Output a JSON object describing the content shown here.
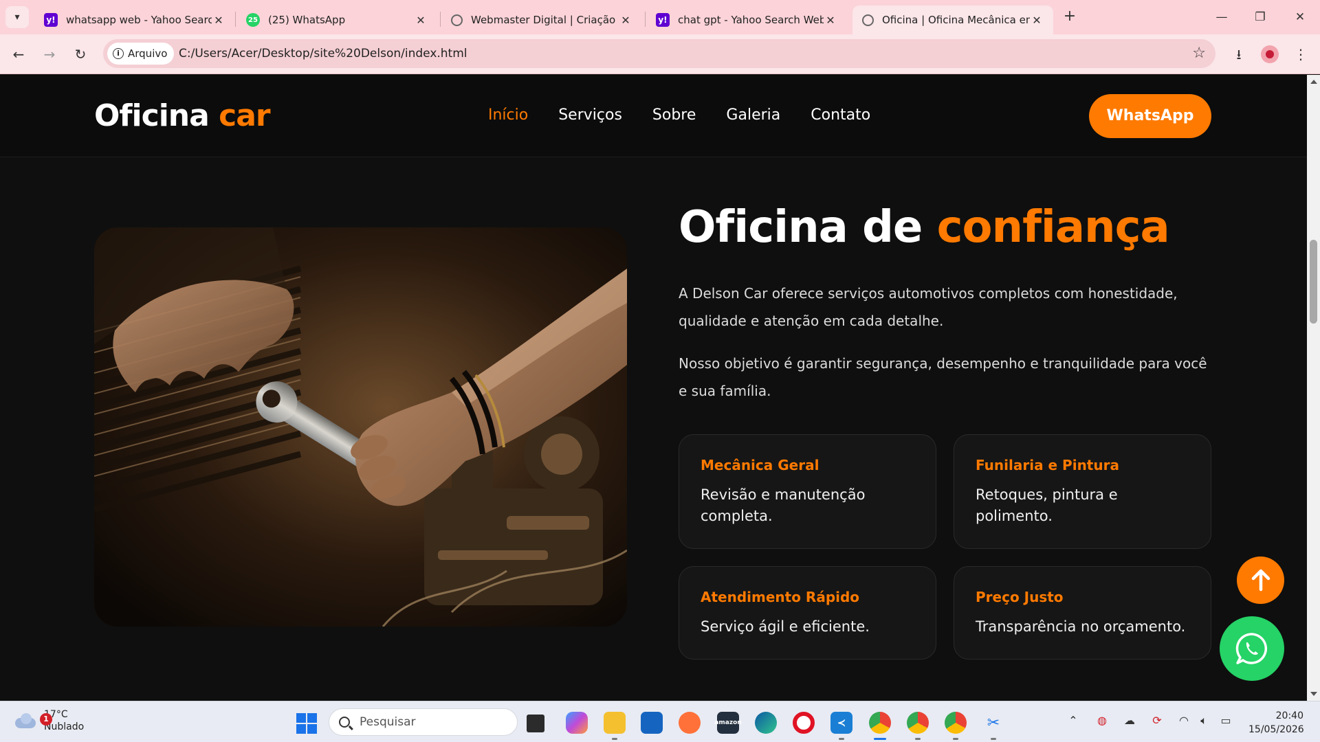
{
  "browser": {
    "tabs": [
      {
        "title": "whatsapp web - Yahoo Search W",
        "favicon": "yahoo-icon",
        "active": false
      },
      {
        "title": "(25) WhatsApp",
        "favicon": "whatsapp-icon",
        "badge": "25",
        "active": false
      },
      {
        "title": "Webmaster Digital | Criação de",
        "favicon": "globe-icon",
        "active": false
      },
      {
        "title": "chat gpt - Yahoo Search Web",
        "favicon": "yahoo-icon",
        "active": false
      },
      {
        "title": "Oficina | Oficina Mecânica em It",
        "favicon": "globe-icon",
        "active": true
      }
    ],
    "address": {
      "chip_label": "Arquivo",
      "url": "C:/Users/Acer/Desktop/site%20Delson/index.html"
    },
    "window_controls": [
      "minimize-icon",
      "restore-icon",
      "close-icon"
    ]
  },
  "site": {
    "logo": {
      "main": "Oficina",
      "accent": "car"
    },
    "nav": [
      "Início",
      "Serviços",
      "Sobre",
      "Galeria",
      "Contato"
    ],
    "nav_active": "Início",
    "cta_label": "WhatsApp",
    "hero": {
      "title_main": "Oficina de",
      "title_accent": "confiança",
      "paragraphs": [
        "A Delson Car oferece serviços automotivos completos com honestidade, qualidade e atenção em cada detalhe.",
        "Nosso objetivo é garantir segurança, desempenho e tranquilidade para você e sua família."
      ]
    },
    "features": [
      {
        "title": "Mecânica Geral",
        "desc": "Revisão e manutenção completa."
      },
      {
        "title": "Funilaria e Pintura",
        "desc": "Retoques, pintura e polimento."
      },
      {
        "title": "Atendimento Rápido",
        "desc": "Serviço ágil e eficiente."
      },
      {
        "title": "Preço Justo",
        "desc": "Transparência no orçamento."
      }
    ],
    "colors": {
      "accent": "#ff7a00",
      "whatsapp": "#25d366",
      "background": "#0f0f0f"
    }
  },
  "taskbar": {
    "weather": {
      "temp": "17°C",
      "condition": "Nublado",
      "badge": "1"
    },
    "search_placeholder": "Pesquisar",
    "clock": {
      "time": "20:40",
      "date": "15/05/2026"
    }
  }
}
